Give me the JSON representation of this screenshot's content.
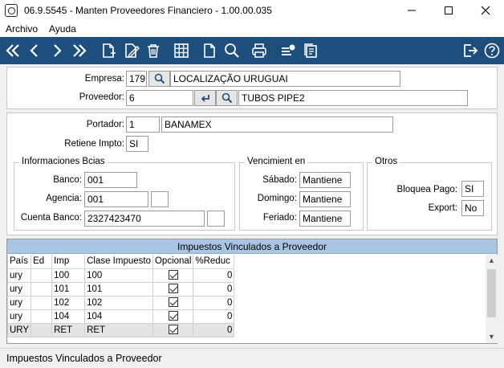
{
  "window": {
    "title": "06.9.5545 - Manten Proveedores Financiero - 1.00.00.035"
  },
  "menu": {
    "items": [
      "Archivo",
      "Ayuda"
    ]
  },
  "colors": {
    "toolbar": "#1e4e7c",
    "grid_header": "#a8c5e1"
  },
  "toolbar": {
    "icons": [
      "first-icon",
      "previous-icon",
      "next-icon",
      "last-icon",
      "new-record-icon",
      "edit-icon",
      "delete-icon",
      "grid-icon",
      "document-icon",
      "search-icon",
      "print-icon",
      "settings-list-icon",
      "copy-icon",
      "exit-icon",
      "help-icon"
    ]
  },
  "header": {
    "empresa_label": "Empresa:",
    "empresa_code": "179",
    "empresa_name": "LOCALIZAÇÃO URUGUAI",
    "proveedor_label": "Proveedor:",
    "proveedor_code": "6",
    "proveedor_name": "TUBOS PIPE2"
  },
  "details": {
    "portador_label": "Portador:",
    "portador_code": "1",
    "portador_name": "BANAMEX",
    "retiene_label": "Retiene Impto:",
    "retiene_value": "SI"
  },
  "bancos": {
    "title": "Informaciones Bcias",
    "banco_label": "Banco:",
    "banco_value": "001",
    "agencia_label": "Agencia:",
    "agencia_value": "001",
    "agencia_dv": "",
    "cuenta_label": "Cuenta Banco:",
    "cuenta_value": "2327423470",
    "cuenta_dv": ""
  },
  "vencimiento": {
    "title": "Vencimient en",
    "sabado_label": "Sábado:",
    "sabado_value": "Mantiene",
    "domingo_label": "Domingo:",
    "domingo_value": "Mantiene",
    "feriado_label": "Feriado:",
    "feriado_value": "Mantiene"
  },
  "otros": {
    "title": "Otros",
    "bloquea_label": "Bloquea Pago:",
    "bloquea_value": "SI",
    "export_label": "Export:",
    "export_value": "No"
  },
  "grid": {
    "title": "Impuestos Vinculados a Proveedor",
    "columns": [
      "País",
      "Ed",
      "Imp",
      "Clase Impuesto",
      "Opcional",
      "%Reduc"
    ],
    "rows": [
      {
        "pais": "ury",
        "ed": "",
        "imp": "100",
        "clase": "100",
        "opcional": true,
        "reduc": "0"
      },
      {
        "pais": "ury",
        "ed": "",
        "imp": "101",
        "clase": "101",
        "opcional": true,
        "reduc": "0"
      },
      {
        "pais": "ury",
        "ed": "",
        "imp": "102",
        "clase": "102",
        "opcional": true,
        "reduc": "0"
      },
      {
        "pais": "ury",
        "ed": "",
        "imp": "104",
        "clase": "104",
        "opcional": true,
        "reduc": "0"
      },
      {
        "pais": "URY",
        "ed": "",
        "imp": "RET",
        "clase": "RET",
        "opcional": true,
        "reduc": "0"
      }
    ]
  },
  "status": {
    "text": "Impuestos Vinculados a Proveedor"
  }
}
